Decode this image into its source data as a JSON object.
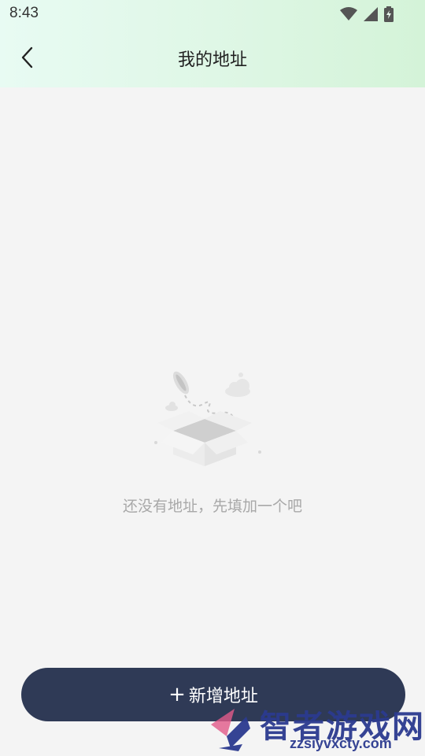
{
  "status_bar": {
    "time": "8:43"
  },
  "navbar": {
    "title": "我的地址"
  },
  "empty_state": {
    "message": "还没有地址，先填加一个吧"
  },
  "add_button": {
    "plus": "+",
    "label": "新增地址"
  },
  "watermark": {
    "brand": "智者游戏网",
    "url": "zzsiyvxcty.com"
  },
  "colors": {
    "button_bg": "#2f3a56",
    "header_gradient_start": "#e8fbf3",
    "header_gradient_end": "#d4f3d8",
    "page_bg": "#f4f4f4"
  },
  "icons": {
    "back": "chevron-left-icon",
    "wifi": "wifi-icon",
    "signal": "cell-signal-icon",
    "battery": "battery-charging-icon"
  }
}
